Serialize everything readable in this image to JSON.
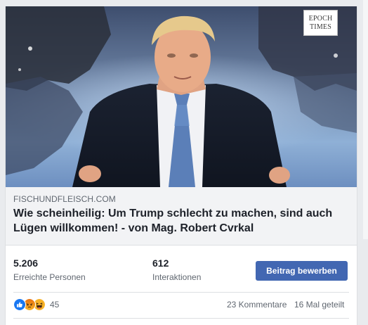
{
  "post": {
    "link_preview": {
      "watermark": {
        "line1": "EPOCH",
        "line2": "TIMES"
      },
      "domain": "FISCHUNDFLEISCH.COM",
      "title": "Wie scheinheilig: Um Trump schlecht zu machen, sind auch Lügen willkommen! - von Mag. Robert Cvrkal"
    },
    "insights": {
      "reach": {
        "value": "5.206",
        "label": "Erreichte Personen"
      },
      "interactions": {
        "value": "612",
        "label": "Interaktionen"
      },
      "boost_button_label": "Beitrag bewerben"
    },
    "reactions": {
      "icons": [
        "like-icon",
        "angry-icon",
        "haha-icon"
      ],
      "count": "45"
    },
    "comments_label": "23 Kommentare",
    "shares_label": "16 Mal geteilt"
  },
  "colors": {
    "brand_blue": "#4267b2",
    "like_blue": "#1877f2",
    "angry_red": "#e9710f",
    "haha_yellow": "#f7b125",
    "background": "#e9ebee",
    "link_meta_bg": "#f2f3f5"
  }
}
